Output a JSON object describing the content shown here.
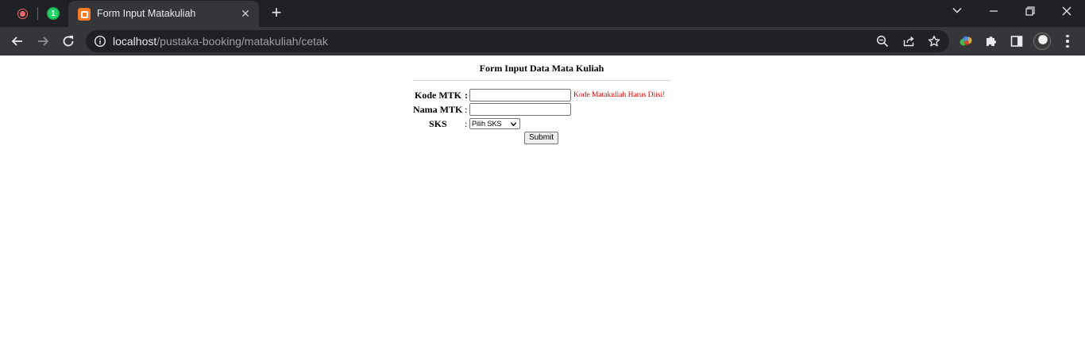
{
  "browser": {
    "whatsapp_badge": "1",
    "tab_title": "Form Input Matakuliah",
    "tab_close": "✕",
    "new_tab": "+",
    "url_host": "localhost",
    "url_path": "/pustaka-booking/matakuliah/cetak"
  },
  "window_controls": {
    "tab_search": "⌄",
    "minimize": "—",
    "restore": "❐",
    "close": "✕"
  },
  "form": {
    "title": "Form Input Data Mata Kuliah",
    "kode_label": "Kode MTK",
    "nama_label": "Nama MTK",
    "sks_label": "SKS",
    "colon": ":",
    "kode_value": "",
    "nama_value": "",
    "kode_error": "Kode Matakuliah Harus Diisi!",
    "sks_selected": "Pilih SKS",
    "submit_label": "Submit"
  },
  "colors": {
    "error": "#e10000",
    "tabstrip": "#202124",
    "toolbar": "#35363a"
  }
}
